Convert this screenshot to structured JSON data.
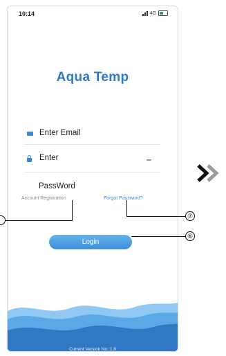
{
  "status_bar": {
    "time": "10:14",
    "network": "4G"
  },
  "app": {
    "title": "Aqua Temp"
  },
  "form": {
    "email_placeholder": "Enter Email",
    "password_placeholder": "Enter",
    "password_label": "PassWord",
    "account_registration": "Account Registration",
    "forgot_password": "Forgot Password?",
    "login_label": "Login"
  },
  "footer": {
    "version": "Current Version No.:1.8"
  },
  "annotations": {
    "forgot_marker": "⑦",
    "login_marker": "⑥"
  },
  "colors": {
    "accent": "#2d78c7",
    "button": "#4a9be0",
    "wave_dark": "#2f78c4",
    "wave_light": "#6fb6ee"
  }
}
